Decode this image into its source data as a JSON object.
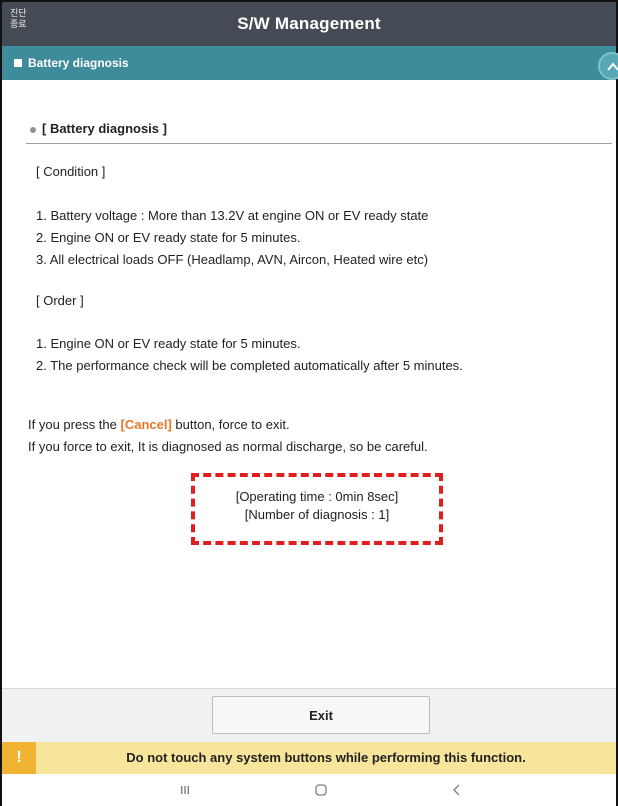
{
  "titlebar": {
    "exit_diag_label": "진단\n종료",
    "title": "S/W Management"
  },
  "section_bar": {
    "label": "Battery diagnosis"
  },
  "content": {
    "heading": "[ Battery diagnosis ]",
    "condition_label": "[ Condition ]",
    "conditions": [
      "1. Battery voltage : More than 13.2V at engine ON or EV ready state",
      "2. Engine ON or EV ready state for 5 minutes.",
      "3. All electrical loads OFF (Headlamp, AVN, Aircon, Heated wire etc)"
    ],
    "order_label": "[ Order ]",
    "orders": [
      "1. Engine ON or EV ready state for 5 minutes.",
      "2. The performance check will be completed automatically after 5 minutes."
    ],
    "notice_prefix": "If you press the ",
    "notice_cancel": "[Cancel]",
    "notice_suffix": " button, force to exit.",
    "notice_line2": "If you force to exit, It is diagnosed as normal discharge, so be careful.",
    "operating_time": "[Operating time : 0min 8sec]",
    "number_of_diagnosis": "[Number of diagnosis : 1]"
  },
  "bottom": {
    "exit_label": "Exit",
    "warning_icon": "!",
    "warning_text": "Do not touch any system buttons while performing this function."
  },
  "colors": {
    "titlebar": "#454b55",
    "section_bar": "#3e8c9b",
    "cancel_highlight": "#e8772e",
    "status_box_border": "#e01e1e",
    "warning_bar": "#f7e59b",
    "warning_icon_bg": "#f0b332"
  },
  "icons": {
    "collapse": "chevron-up-icon",
    "nav_recent": "recent-apps-icon",
    "nav_home": "home-icon",
    "nav_back": "back-icon"
  }
}
